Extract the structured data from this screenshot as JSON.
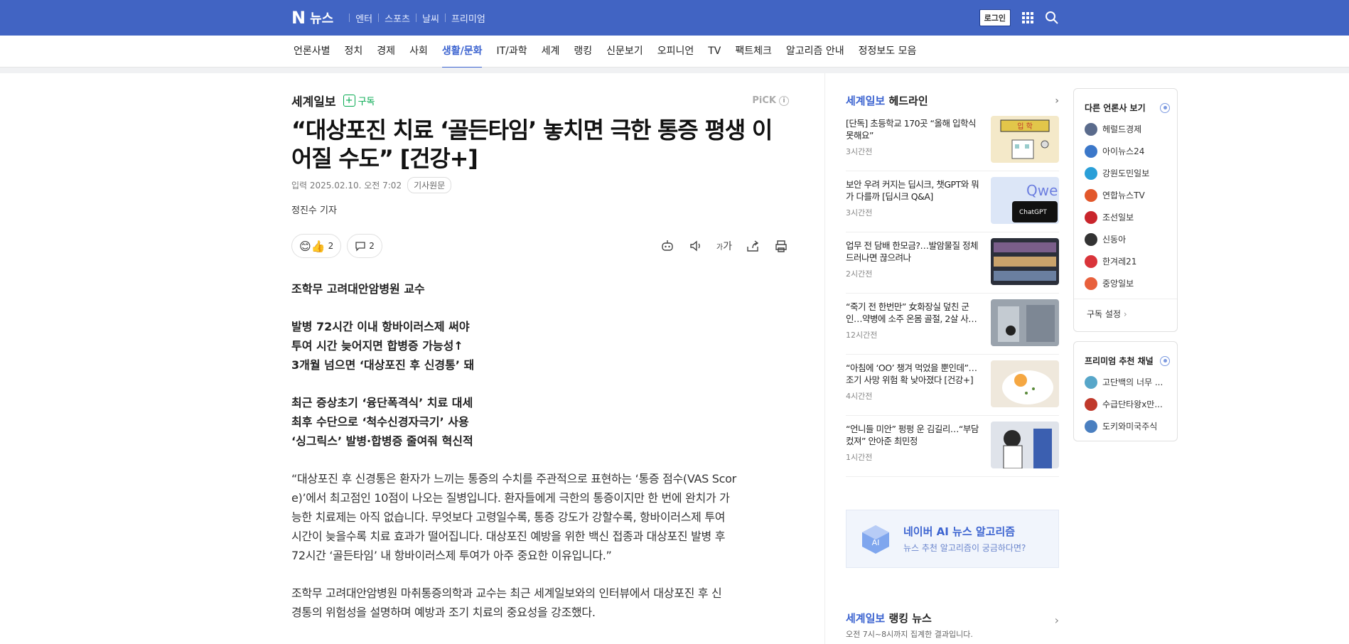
{
  "topbar": {
    "logo_n": "N",
    "logo_news": "뉴스",
    "links": [
      "엔터",
      "스포츠",
      "날씨",
      "프리미엄"
    ],
    "login": "로그인",
    "bg_color": "#4164c3"
  },
  "nav": {
    "items": [
      "언론사별",
      "정치",
      "경제",
      "사회",
      "생활/문화",
      "IT/과학",
      "세계",
      "랭킹",
      "신문보기",
      "오피니언",
      "TV",
      "팩트체크",
      "알고리즘 안내",
      "정정보도 모음"
    ],
    "active": "생활/문화"
  },
  "article": {
    "press": "세계일보",
    "subscribe": "구독",
    "pick": "PiCK",
    "title": "“대상포진 치료 ‘골든타임’ 놓치면 극한 통증 평생 이어질 수도” [건강+]",
    "date": "입력 2025.02.10. 오전 7:02",
    "original_link": "기사원문",
    "reporter": "정진수 기자",
    "reaction_count": "2",
    "comment_count": "2",
    "font_tool": "가",
    "lead": "조학무 고려대안암병원 교수",
    "subheads_1": [
      "발병 72시간 이내 항바이러스제 써야",
      "투여 시간 늦어지면 합병증 가능성↑",
      "3개월 넘으면 ‘대상포진 후 신경통’ 돼"
    ],
    "subheads_2": [
      "최근 증상초기 ‘융단폭격식’ 치료 대세",
      "최후 수단으로 ‘척수신경자극기’ 사용",
      "‘싱그릭스’ 발병·합병증 줄여줘 혁신적"
    ],
    "para1": [
      "“대상포진 후 신경통은 환자가 느끼는 통증의 수치를 주관적으로 표현하는 ‘통증 점수(VAS Scor",
      "e)’에서 최고점인 10점이 나오는 질병입니다. 환자들에게 극한의 통증이지만 한 번에 완치가 가",
      "능한 치료제는 아직 없습니다. 무엇보다 고령일수록, 통증 강도가 강할수록, 항바이러스제 투여",
      "시간이 늦을수록 치료 효과가 떨어집니다. 대상포진 예방을 위한 백신 접종과 대상포진 발병 후",
      "72시간 ‘골든타임’ 내 항바이러스제 투여가 아주 중요한 이유입니다.”"
    ],
    "para2": [
      "조학무 고려대안암병원 마취통증의학과 교수는 최근 세계일보와의 인터뷰에서 대상포진 후 신",
      "경통의 위험성을 설명하며 예방과 조기 치료의 중요성을 강조했다."
    ]
  },
  "rail": {
    "press": "세계일보",
    "head_suffix": "헤드라인",
    "items": [
      {
        "title": "[단독] 초등학교 170곳 “올해 입학식 못해요”",
        "time": "3시간전",
        "thumb": "school"
      },
      {
        "title": "보안 우려 커지는 딥시크, 챗GPT와 뭐가 다를까 [딥시크 Q&A]",
        "time": "3시간전",
        "thumb": "qwen"
      },
      {
        "title": "업무 전 담배 한모금?…발암물질 정체 드러나면 끊으려나",
        "time": "2시간전",
        "thumb": "shelf"
      },
      {
        "title": "“죽기 전 한번만” 女화장실 덮친 군인…약병에 소주 온몸 골절, 2살 사…",
        "time": "12시간전",
        "thumb": "bottle"
      },
      {
        "title": "“아침에 ‘OO’ 챙겨 먹었을 뿐인데”…조기 사망 위험 확 낮아졌다 [건강+]",
        "time": "4시간전",
        "thumb": "egg"
      },
      {
        "title": "“언니들 미안” 펑펑 운 김길리…“부담 컸져” 안아준 최민정",
        "time": "1시간전",
        "thumb": "skater"
      }
    ],
    "banner_title": "네이버 AI 뉴스 알고리즘",
    "banner_sub": "뉴스 추천 알고리즘이 궁금하다면?",
    "banner_icon_text": "AI",
    "rank_press": "세계일보",
    "rank_suffix": "랭킹 뉴스",
    "rank_sub": "오전 7시~8시까지 집계한 결과입니다."
  },
  "side": {
    "press_title": "다른 언론사 보기",
    "press_list": [
      {
        "name": "헤럴드경제",
        "color": "#5a6b8c"
      },
      {
        "name": "아이뉴스24",
        "color": "#3b77c9"
      },
      {
        "name": "강원도민일보",
        "color": "#2a9fd8"
      },
      {
        "name": "연합뉴스TV",
        "color": "#e2572b"
      },
      {
        "name": "조선일보",
        "color": "#c9252c"
      },
      {
        "name": "신동아",
        "color": "#333333"
      },
      {
        "name": "한겨레21",
        "color": "#d9343a"
      },
      {
        "name": "중앙일보",
        "color": "#e8603c"
      }
    ],
    "subscribe_setting": "구독 설정",
    "premium_title": "프리미엄 추천 채널",
    "premium_list": [
      {
        "name": "고단백의 너무 ...",
        "color": "#57a6c9"
      },
      {
        "name": "수급단타왕x만...",
        "color": "#c0392b"
      },
      {
        "name": "도키와미국주식",
        "color": "#4a7fc0"
      }
    ]
  }
}
